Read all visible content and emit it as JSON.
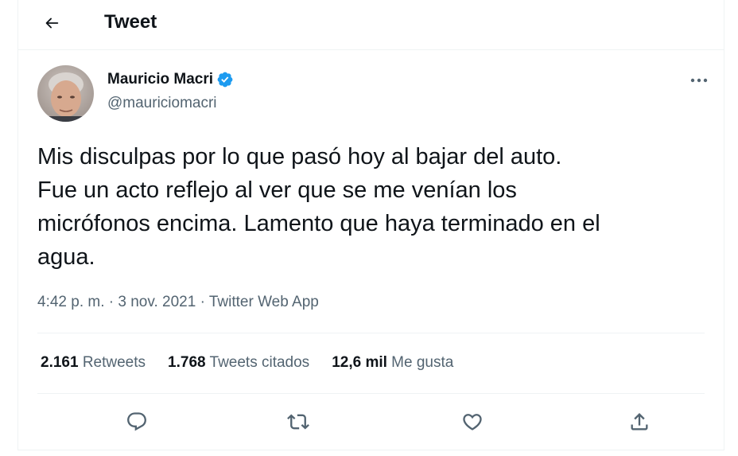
{
  "header": {
    "back_icon": "arrow-left-icon",
    "title": "Tweet"
  },
  "tweet": {
    "author": {
      "name": "Mauricio Macri",
      "handle": "@mauriciomacri",
      "verified": true,
      "verified_icon": "verified-badge-icon",
      "verified_color": "#1d9bf0"
    },
    "more_icon": "more-horizontal-icon",
    "text": "Mis disculpas por lo que pasó hoy al bajar del auto.\nFue un acto reflejo al ver que se me venían los\nmicrófonos encima. Lamento que haya terminado en el\nagua.",
    "time": "4:42 p. m.",
    "separator": " · ",
    "date": "3 nov. 2021",
    "source": "Twitter Web App"
  },
  "stats": {
    "retweets_count": "2.161",
    "retweets_label": " Retweets",
    "quotes_count": "1.768",
    "quotes_label": " Tweets citados",
    "likes_count": "12,6 mil",
    "likes_label": " Me gusta"
  },
  "actions": {
    "reply_icon": "reply-icon",
    "retweet_icon": "retweet-icon",
    "like_icon": "heart-icon",
    "share_icon": "share-icon"
  },
  "colors": {
    "text_primary": "#0f1419",
    "text_secondary": "#536471",
    "border": "#eff3f4",
    "accent": "#1d9bf0"
  }
}
